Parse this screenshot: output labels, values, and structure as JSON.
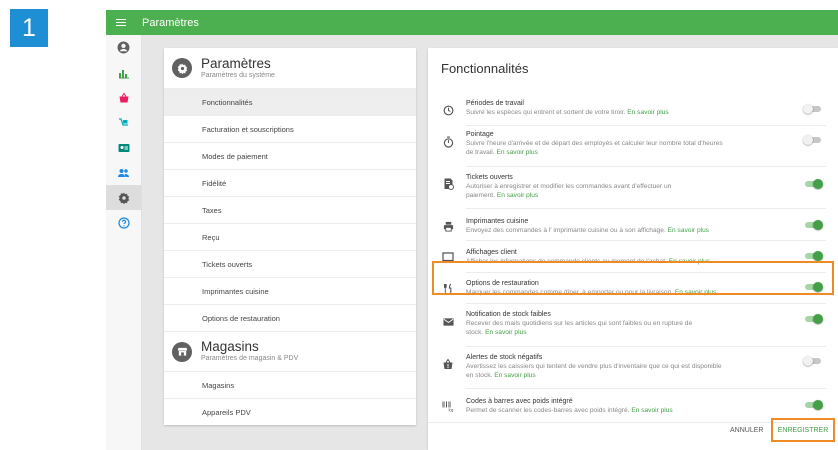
{
  "step": {
    "number": "1"
  },
  "topbar": {
    "title": "Paramètres"
  },
  "nav": {
    "items": [
      "account-icon",
      "reports-icon",
      "items-icon",
      "inventory-icon",
      "customers-icon",
      "employees-icon",
      "settings-icon",
      "help-icon"
    ],
    "active": "settings-icon"
  },
  "settings_section": {
    "title": "Paramètres",
    "subtitle": "Paramètres du système",
    "items": [
      {
        "label": "Fonctionnalités",
        "active": true
      },
      {
        "label": "Facturation et souscriptions"
      },
      {
        "label": "Modes de paiement"
      },
      {
        "label": "Fidélité"
      },
      {
        "label": "Taxes"
      },
      {
        "label": "Reçu"
      },
      {
        "label": "Tickets ouverts"
      },
      {
        "label": "Imprimantes cuisine"
      },
      {
        "label": "Options de restauration"
      }
    ]
  },
  "stores_section": {
    "title": "Magasins",
    "subtitle": "Paramètres de magasin & PDV",
    "items": [
      {
        "label": "Magasins"
      },
      {
        "label": "Appareils PDV"
      }
    ]
  },
  "features": {
    "title": "Fonctionnalités",
    "learn_more": "En savoir plus",
    "items": [
      {
        "name": "Périodes de travail",
        "desc1": "Suivre les espèces qui entrent et sortent de votre tiroir.",
        "desc2": "",
        "icon": "clock-icon",
        "enabled": false
      },
      {
        "name": "Pointage",
        "desc1": "Suivre l'heure d'arrivée et de départ des employés et calculer leur nombre total d'heures",
        "desc2": "de travail.",
        "icon": "stopwatch-icon",
        "enabled": false
      },
      {
        "name": "Tickets ouverts",
        "desc1": "Autoriser à enregistrer et modifier les commandes avant d'effectuer un",
        "desc2": "paiement.",
        "icon": "ticket-icon",
        "enabled": true
      },
      {
        "name": "Imprimantes cuisine",
        "desc1": "Envoyez des commandes à l' imprimante cuisine ou à son affichage.",
        "desc2": "",
        "icon": "printer-icon",
        "enabled": true
      },
      {
        "name": "Affichages client",
        "desc1": "Afficher les informations de commande clients au moment de l'achat.",
        "desc2": "",
        "icon": "monitor-icon",
        "enabled": true
      },
      {
        "name": "Options de restauration",
        "desc1": "Marquer les commandes comme dîner, à emporter ou pour la livraison.",
        "desc2": "",
        "icon": "fork-knife-icon",
        "enabled": true
      },
      {
        "name": "Notification de stock faibles",
        "desc1": "Recever des mails quotidiens sur les articles qui sont faibles ou en rupture de",
        "desc2": "stock.",
        "icon": "mail-icon",
        "enabled": true
      },
      {
        "name": "Alertes de stock négatifs",
        "desc1": "Avertissez les caissiers qui tentent de vendre plus d'inventaire que ce qui est disponible",
        "desc2": "en stock.",
        "icon": "alert-bag-icon",
        "enabled": false
      },
      {
        "name": "Codes à barres avec poids intégré",
        "desc1": "Permet de scanner les codes-barres avec poids intégré.",
        "desc2": "",
        "icon": "barcode-kg-icon",
        "enabled": true
      }
    ]
  },
  "actions": {
    "cancel": "ANNULER",
    "save": "ENREGISTRER"
  },
  "colors": {
    "primary_green": "#4caf50",
    "link_green": "#43a047",
    "highlight_orange": "#f08a24",
    "step_blue": "#1e8fd5"
  }
}
